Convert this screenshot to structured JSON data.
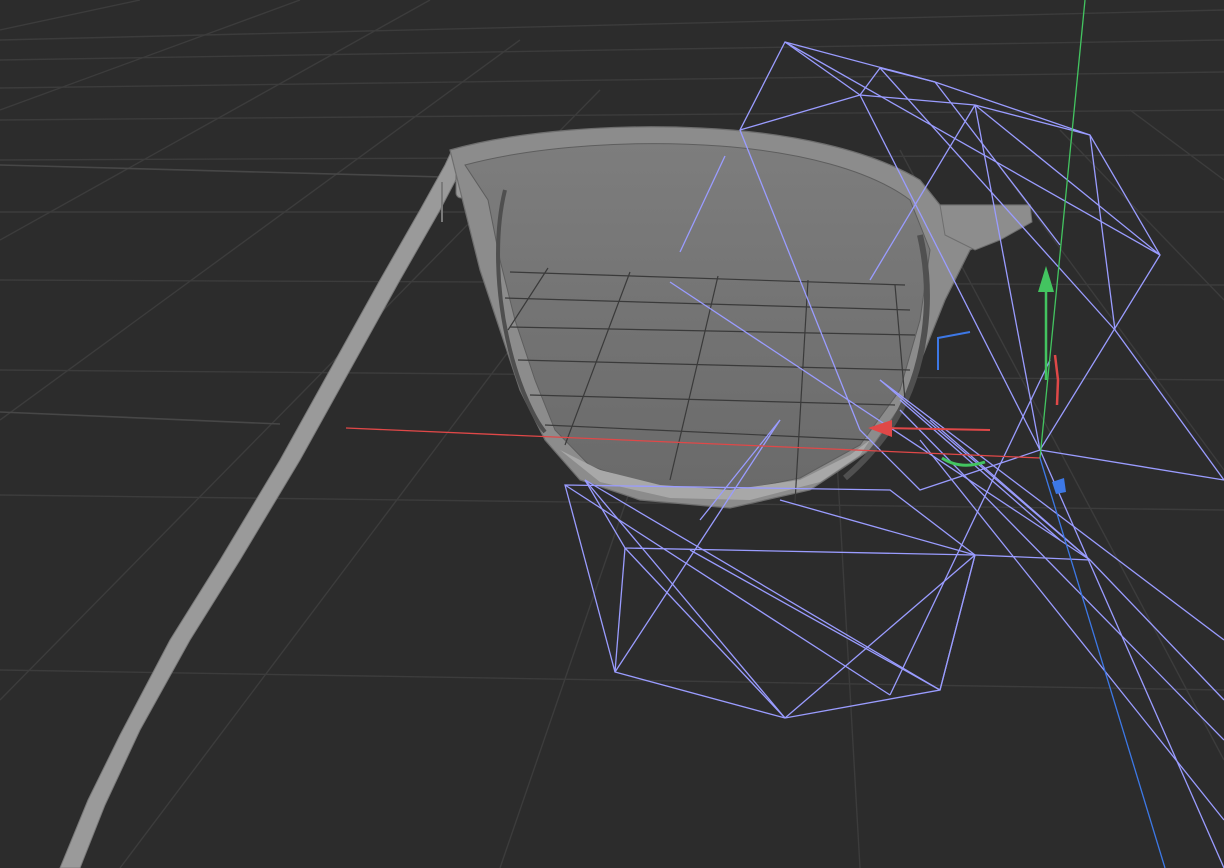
{
  "viewport": {
    "background_color": "#2c2c2c",
    "grid_color": "#3c3c3c",
    "grid_major_color": "#474747",
    "mesh_color": "#8a8a8a",
    "mesh_dark_color": "#6f6f6f",
    "wireframe_color": "#9a9cff",
    "axis_colors": {
      "x": "#e04848",
      "y": "#43c460",
      "z": "#3d78e6"
    }
  },
  "icons": {
    "move_gizmo": "move-gizmo-icon",
    "rotate_gizmo": "rotate-gizmo-icon"
  }
}
